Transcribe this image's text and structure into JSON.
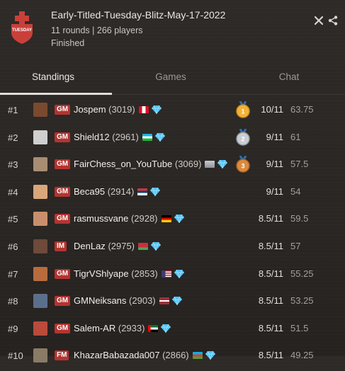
{
  "tournament": {
    "title": "Early-Titled-Tuesday-Blitz-May-17-2022",
    "info": "11 rounds | 266 players",
    "status": "Finished",
    "logo_text": "TUESDAY"
  },
  "header_icons": [
    "close-icon",
    "share-icon"
  ],
  "tabs": [
    {
      "label": "Standings",
      "active": true
    },
    {
      "label": "Games",
      "active": false
    },
    {
      "label": "Chat",
      "active": false
    }
  ],
  "colors": {
    "title_badge": "#b33430",
    "accent_text": "#e8e6e3",
    "diamond": "#4fc3f7"
  },
  "standings": [
    {
      "rank": "#1",
      "title": "GM",
      "name": "Jospem",
      "rating": "(3019)",
      "flag": "peru",
      "medal": "gold",
      "score": "10/11",
      "tiebreak": "63.75"
    },
    {
      "rank": "#2",
      "title": "GM",
      "name": "Shield12",
      "rating": "(2961)",
      "flag": "uzbekistan",
      "medal": "silver",
      "score": "9/11",
      "tiebreak": "61"
    },
    {
      "rank": "#3",
      "title": "GM",
      "name": "FairChess_on_YouTube",
      "rating": "(3069)",
      "flag": "international",
      "medal": "bronze",
      "score": "9/11",
      "tiebreak": "57.5"
    },
    {
      "rank": "#4",
      "title": "GM",
      "name": "Beca95",
      "rating": "(2914)",
      "flag": "serbia",
      "medal": "",
      "score": "9/11",
      "tiebreak": "54"
    },
    {
      "rank": "#5",
      "title": "GM",
      "name": "rasmussvane",
      "rating": "(2928)",
      "flag": "germany",
      "medal": "",
      "score": "8.5/11",
      "tiebreak": "59.5"
    },
    {
      "rank": "#6",
      "title": "IM",
      "name": "DenLaz",
      "rating": "(2975)",
      "flag": "belarus",
      "medal": "",
      "score": "8.5/11",
      "tiebreak": "57"
    },
    {
      "rank": "#7",
      "title": "GM",
      "name": "TigrVShlyape",
      "rating": "(2853)",
      "flag": "usa",
      "medal": "",
      "score": "8.5/11",
      "tiebreak": "55.25"
    },
    {
      "rank": "#8",
      "title": "GM",
      "name": "GMNeiksans",
      "rating": "(2903)",
      "flag": "latvia",
      "medal": "",
      "score": "8.5/11",
      "tiebreak": "53.25"
    },
    {
      "rank": "#9",
      "title": "GM",
      "name": "Salem-AR",
      "rating": "(2933)",
      "flag": "uae",
      "medal": "",
      "score": "8.5/11",
      "tiebreak": "51.5"
    },
    {
      "rank": "#10",
      "title": "FM",
      "name": "KhazarBabazada007",
      "rating": "(2866)",
      "flag": "azerbaijan",
      "medal": "",
      "score": "8.5/11",
      "tiebreak": "49.25"
    }
  ]
}
